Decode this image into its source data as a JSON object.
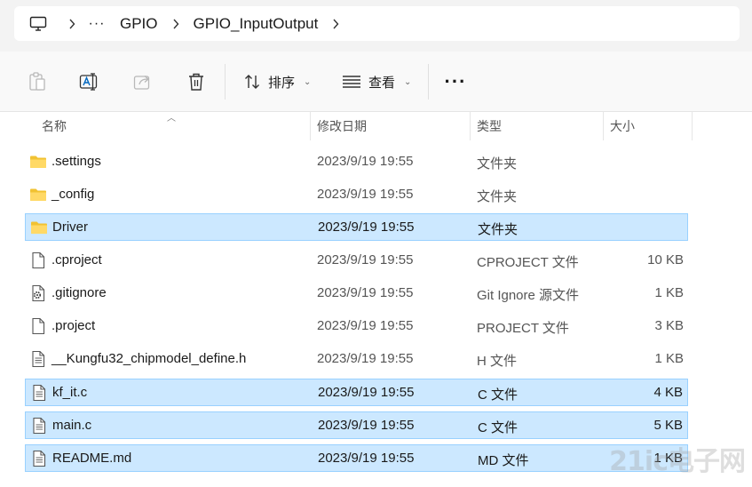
{
  "address_bar": {
    "more_label": "···",
    "crumbs": [
      "GPIO",
      "GPIO_InputOutput"
    ]
  },
  "toolbar": {
    "sort_label": "排序",
    "view_label": "查看",
    "more_label": "···"
  },
  "columns": {
    "name": "名称",
    "modified": "修改日期",
    "type": "类型",
    "size": "大小"
  },
  "files": [
    {
      "name": ".settings",
      "modified": "2023/9/19 19:55",
      "type": "文件夹",
      "size": "",
      "icon": "folder-icon",
      "selected": false
    },
    {
      "name": "_config",
      "modified": "2023/9/19 19:55",
      "type": "文件夹",
      "size": "",
      "icon": "folder-icon",
      "selected": false
    },
    {
      "name": "Driver",
      "modified": "2023/9/19 19:55",
      "type": "文件夹",
      "size": "",
      "icon": "folder-icon",
      "selected": true
    },
    {
      "name": ".cproject",
      "modified": "2023/9/19 19:55",
      "type": "CPROJECT 文件",
      "size": "10 KB",
      "icon": "blank-file-icon",
      "selected": false
    },
    {
      "name": ".gitignore",
      "modified": "2023/9/19 19:55",
      "type": "Git Ignore 源文件",
      "size": "1 KB",
      "icon": "settings-file-icon",
      "selected": false
    },
    {
      "name": ".project",
      "modified": "2023/9/19 19:55",
      "type": "PROJECT 文件",
      "size": "3 KB",
      "icon": "blank-file-icon",
      "selected": false
    },
    {
      "name": "__Kungfu32_chipmodel_define.h",
      "modified": "2023/9/19 19:55",
      "type": "H 文件",
      "size": "1 KB",
      "icon": "text-file-icon",
      "selected": false
    },
    {
      "name": "kf_it.c",
      "modified": "2023/9/19 19:55",
      "type": "C 文件",
      "size": "4 KB",
      "icon": "text-file-icon",
      "selected": true
    },
    {
      "name": "main.c",
      "modified": "2023/9/19 19:55",
      "type": "C 文件",
      "size": "5 KB",
      "icon": "text-file-icon",
      "selected": true
    },
    {
      "name": "README.md",
      "modified": "2023/9/19 19:55",
      "type": "MD 文件",
      "size": "1 KB",
      "icon": "text-file-icon",
      "selected": true
    }
  ],
  "watermark": "21ic电子网"
}
